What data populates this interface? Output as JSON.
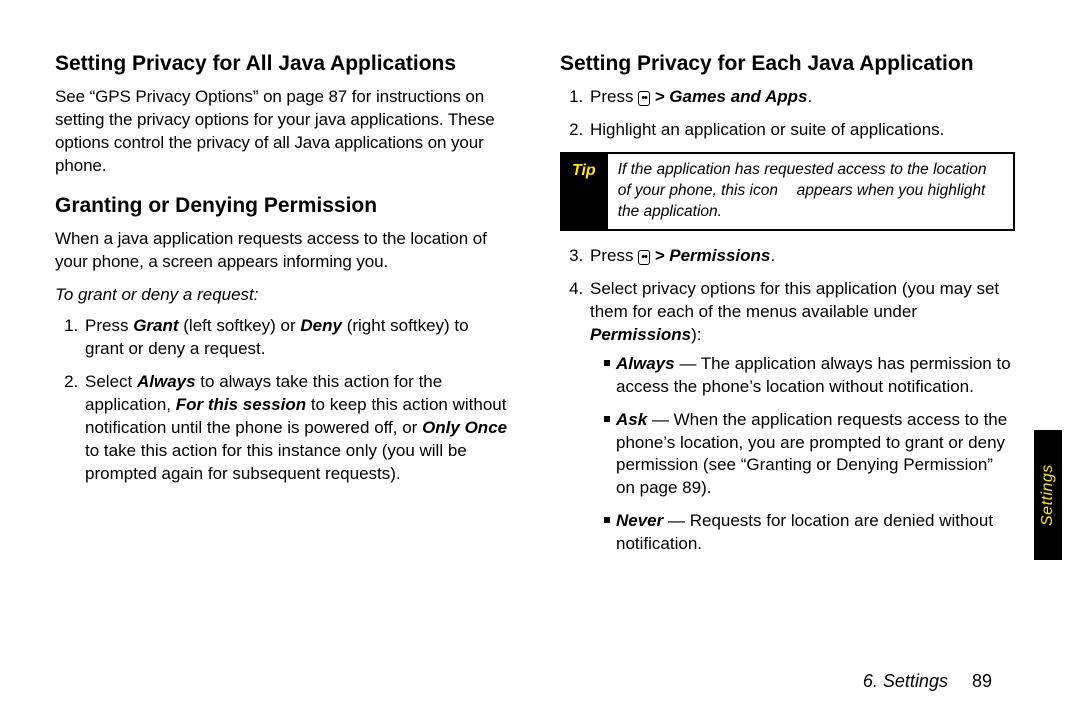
{
  "left": {
    "h1": "Setting Privacy for All Java Applications",
    "p1": "See “GPS Privacy Options” on page 87 for instructions on setting the privacy options for your java applications. These options control the privacy of all Java applications on your phone.",
    "h2": "Granting or Denying Permission",
    "p2": "When a java application requests access to the location of your phone, a screen appears informing you.",
    "instr": "To grant or deny a request:",
    "ol1_a": "Press ",
    "ol1_grant": "Grant",
    "ol1_b": " (left softkey) or ",
    "ol1_deny": "Deny",
    "ol1_c": " (right softkey) to grant or deny a request.",
    "ol2_a": "Select ",
    "ol2_always": "Always",
    "ol2_b": " to always take this action for the application, ",
    "ol2_session": "For this session",
    "ol2_c": " to keep this action without notification until the phone is powered off, or ",
    "ol2_once": "Only Once",
    "ol2_d": " to take this action for this instance only (you will be prompted again for subsequent requests)."
  },
  "right": {
    "h1": "Setting Privacy for Each Java Application",
    "step1_a": "Press ",
    "step1_b": " > ",
    "step1_c": "Games and Apps",
    "step1_d": ".",
    "step2": "Highlight an application or suite of applications.",
    "tip_label": "Tip",
    "tip_a": "If the application has requested access to the location of your phone, this icon ",
    "tip_b": " appears when you highlight the application.",
    "step3_a": "Press ",
    "step3_b": " > ",
    "step3_c": "Permissions",
    "step3_d": ".",
    "step4_a": "Select privacy options for this application (you may set them for each of the menus available under ",
    "step4_b": "Permissions",
    "step4_c": "):",
    "opt_always_label": "Always",
    "opt_always_text": " — The application always has permission to access the phone’s location without notification.",
    "opt_ask_label": "Ask",
    "opt_ask_text": " — When the application requests access to the phone’s location, you are prompted to grant or deny permission (see “Granting or Denying Permission” on page 89).",
    "opt_never_label": "Never",
    "opt_never_text": " — Requests for location are denied without notification."
  },
  "footer": {
    "chapter": "6. Settings",
    "page": "89"
  },
  "sidetab": "Settings",
  "key_glyph": "••"
}
